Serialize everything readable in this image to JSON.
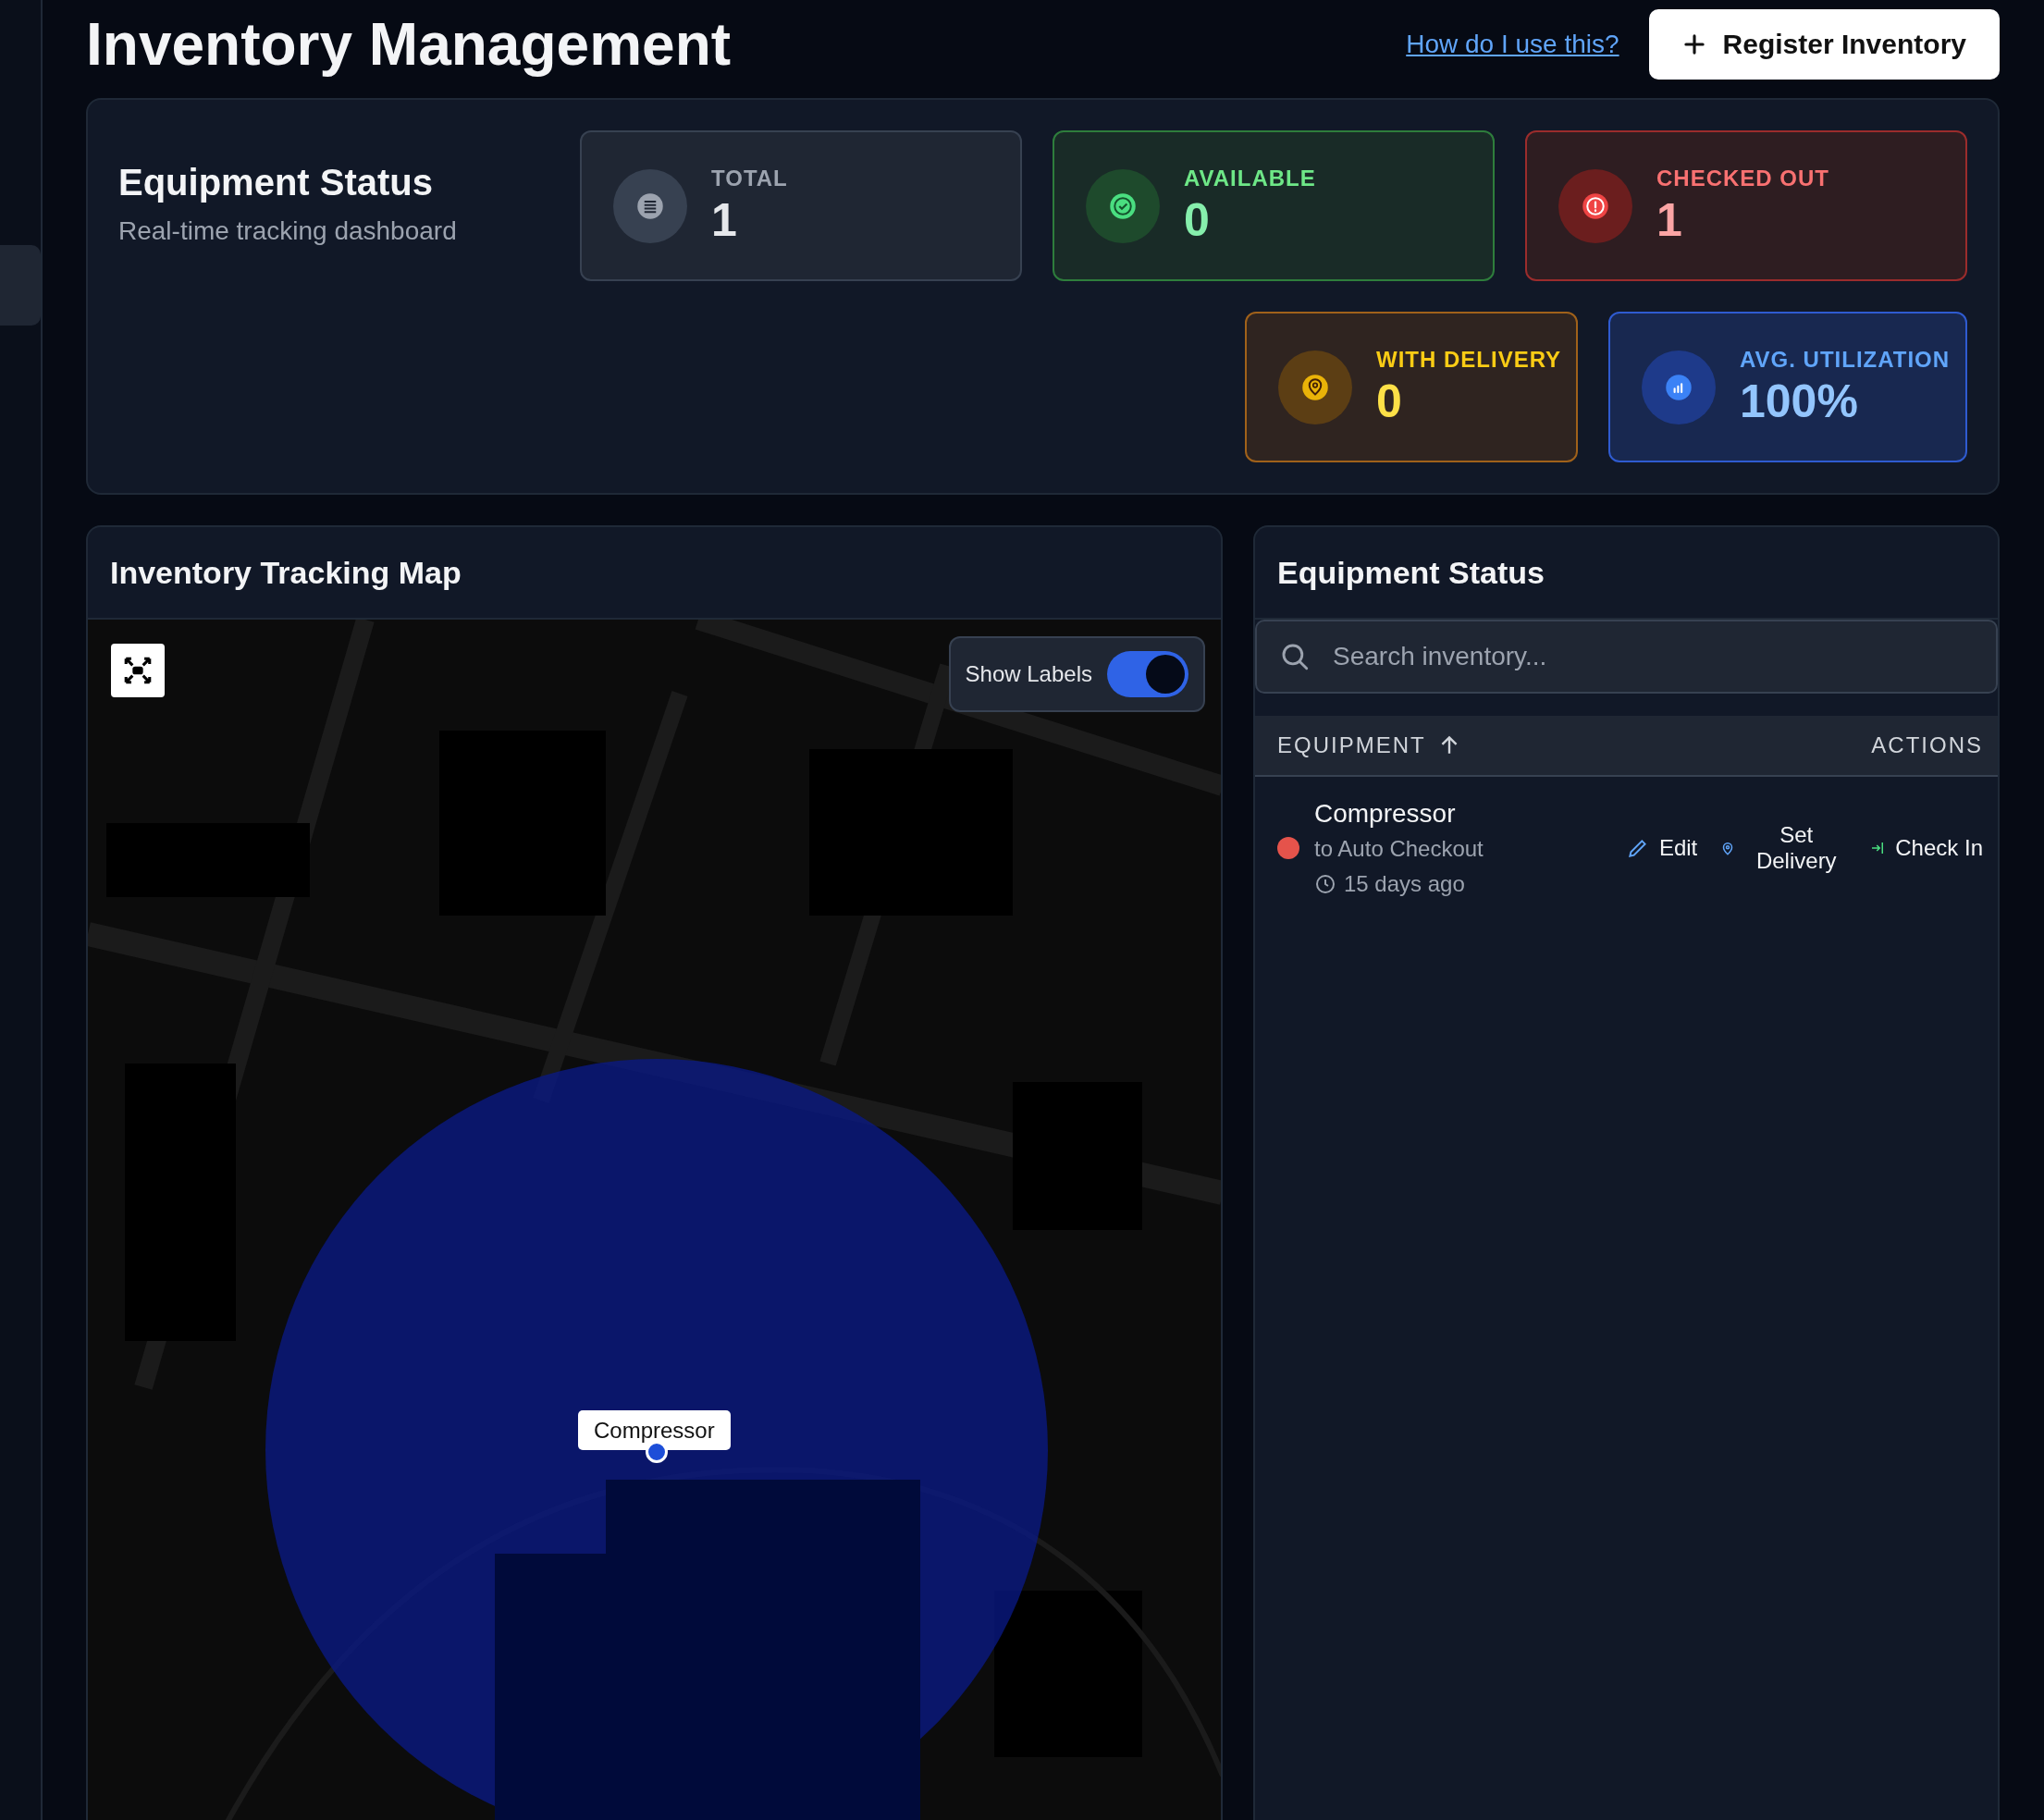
{
  "page": {
    "title": "Inventory Management",
    "help_link": "How do I use this?",
    "primary_button": "Register Inventory"
  },
  "summary": {
    "title": "Equipment Status",
    "subtitle": "Real-time tracking dashboard",
    "cards": [
      {
        "kind": "neutral",
        "label": "TOTAL",
        "value": "1"
      },
      {
        "kind": "success",
        "label": "AVAILABLE",
        "value": "0"
      },
      {
        "kind": "danger",
        "label": "CHECKED OUT",
        "value": "1"
      },
      {
        "kind": "warning",
        "label": "WITH DELIVERY",
        "value": "0"
      },
      {
        "kind": "info",
        "label": "AVG. UTILIZATION",
        "value": "100%"
      }
    ]
  },
  "map": {
    "title": "Inventory Tracking Map",
    "show_labels": {
      "label": "Show Labels",
      "on": true
    },
    "marker": {
      "label": "Compressor"
    }
  },
  "equipment": {
    "title": "Equipment Status",
    "search": {
      "placeholder": "Search inventory..."
    },
    "columns": [
      {
        "label": "EQUIPMENT",
        "sorted_ascending": true
      },
      {
        "label": "ACTIONS"
      }
    ],
    "rows": [
      {
        "name": "Compressor",
        "color": "#e5534b",
        "subtitle": "to Auto Checkout",
        "time": "15 days ago",
        "actions": [
          {
            "kind": "edit",
            "label": "Edit"
          },
          {
            "kind": "delivery",
            "label": "Set Delivery"
          },
          {
            "kind": "checkin",
            "label": "Check In"
          }
        ]
      }
    ]
  }
}
